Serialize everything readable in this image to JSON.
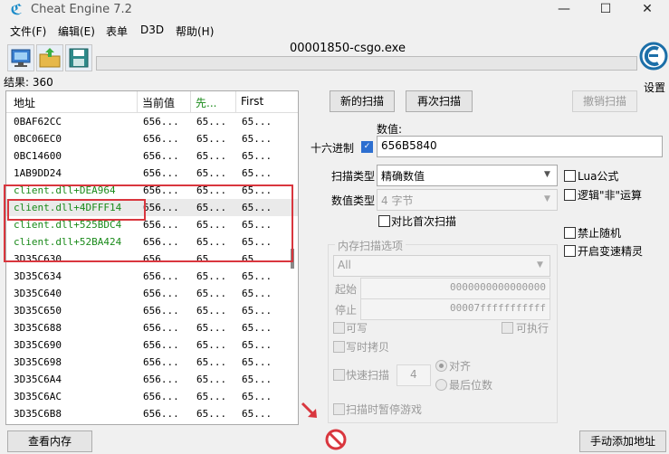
{
  "window": {
    "title": "Cheat Engine 7.2",
    "minimize": "—",
    "maximize": "☐",
    "close": "✕"
  },
  "menu": [
    "文件(F)",
    "编辑(E)",
    "表单",
    "D3D",
    "帮助(H)"
  ],
  "process_title": "00001850-csgo.exe",
  "settings_label": "设置",
  "results_label": "结果: 360",
  "list": {
    "headers": [
      "地址",
      "当前值",
      "先...",
      "First"
    ],
    "rows": [
      {
        "address": "0BAF62CC",
        "current": "656...",
        "previous": "65...",
        "first": "65...",
        "module": false
      },
      {
        "address": "0BC06EC0",
        "current": "656...",
        "previous": "65...",
        "first": "65...",
        "module": false
      },
      {
        "address": "0BC14600",
        "current": "656...",
        "previous": "65...",
        "first": "65...",
        "module": false
      },
      {
        "address": "1AB9DD24",
        "current": "656...",
        "previous": "65...",
        "first": "65...",
        "module": false
      },
      {
        "address": "client.dll+DEA964",
        "current": "656...",
        "previous": "65...",
        "first": "65...",
        "module": true
      },
      {
        "address": "client.dll+4DFFF14",
        "current": "656...",
        "previous": "65...",
        "first": "65...",
        "module": true
      },
      {
        "address": "client.dll+525BDC4",
        "current": "656...",
        "previous": "65...",
        "first": "65...",
        "module": true
      },
      {
        "address": "client.dll+52BA424",
        "current": "656...",
        "previous": "65...",
        "first": "65...",
        "module": true
      },
      {
        "address": "3D35C630",
        "current": "656...",
        "previous": "65...",
        "first": "65...",
        "module": false
      },
      {
        "address": "3D35C634",
        "current": "656...",
        "previous": "65...",
        "first": "65...",
        "module": false
      },
      {
        "address": "3D35C640",
        "current": "656...",
        "previous": "65...",
        "first": "65...",
        "module": false
      },
      {
        "address": "3D35C650",
        "current": "656...",
        "previous": "65...",
        "first": "65...",
        "module": false
      },
      {
        "address": "3D35C688",
        "current": "656...",
        "previous": "65...",
        "first": "65...",
        "module": false
      },
      {
        "address": "3D35C690",
        "current": "656...",
        "previous": "65...",
        "first": "65...",
        "module": false
      },
      {
        "address": "3D35C698",
        "current": "656...",
        "previous": "65...",
        "first": "65...",
        "module": false
      },
      {
        "address": "3D35C6A4",
        "current": "656...",
        "previous": "65...",
        "first": "65...",
        "module": false
      },
      {
        "address": "3D35C6AC",
        "current": "656...",
        "previous": "65...",
        "first": "65...",
        "module": false
      },
      {
        "address": "3D35C6B8",
        "current": "656...",
        "previous": "65...",
        "first": "65...",
        "module": false
      }
    ]
  },
  "buttons": {
    "new_scan": "新的扫描",
    "next_scan": "再次扫描",
    "undo_scan": "撤销扫描",
    "view_memory": "查看内存",
    "add_address": "手动添加地址"
  },
  "value": {
    "label": "数值:",
    "hex_label": "十六进制",
    "hex_checked": true,
    "input": "656B5840"
  },
  "scan_type": {
    "label": "扫描类型",
    "selected": "精确数值"
  },
  "value_type": {
    "label": "数值类型",
    "selected": "4 字节"
  },
  "compare_first": "对比首次扫描",
  "options_right": {
    "lua": "Lua公式",
    "not": "逻辑\"非\"运算",
    "no_random": "禁止随机",
    "speedhack": "开启变速精灵"
  },
  "mem_options": {
    "title": "内存扫描选项",
    "region": "All",
    "start_label": "起始",
    "start_value": "0000000000000000",
    "stop_label": "停止",
    "stop_value": "00007fffffffffff",
    "writable": "可写",
    "executable": "可执行",
    "copy_on_write": "写时拷贝",
    "fast_scan": "快速扫描",
    "fast_scan_value": "4",
    "align": "对齐",
    "last_digits": "最后位数",
    "pause_game": "扫描时暂停游戏"
  },
  "colors": {
    "module_green": "#1a8a1a",
    "highlight_red": "#d9363e",
    "accent_blue": "#2d6fd0"
  }
}
